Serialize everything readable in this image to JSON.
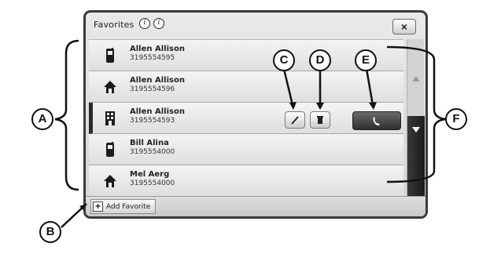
{
  "window": {
    "title": "Favorites",
    "help_glyph": "i",
    "info_glyph": "i",
    "close_label": "×"
  },
  "contacts": [
    {
      "name": "Allen Allison",
      "number": "3195554595",
      "type": "mobile-phone-icon"
    },
    {
      "name": "Allen Allison",
      "number": "3195554596",
      "type": "home-icon"
    },
    {
      "name": "Allen Allison",
      "number": "3195554593",
      "type": "office-building-icon"
    },
    {
      "name": "Bill Alina",
      "number": "3195554000",
      "type": "mobile-phone-icon"
    },
    {
      "name": "Mel Aerg",
      "number": "3195554000",
      "type": "home-icon"
    }
  ],
  "selected_row": 2,
  "bottom_bar": {
    "add_favorite_label": "Add Favorite",
    "plus_glyph": "+"
  },
  "callouts": {
    "a": "A",
    "b": "B",
    "c": "C",
    "d": "D",
    "e": "E",
    "f": "F"
  }
}
